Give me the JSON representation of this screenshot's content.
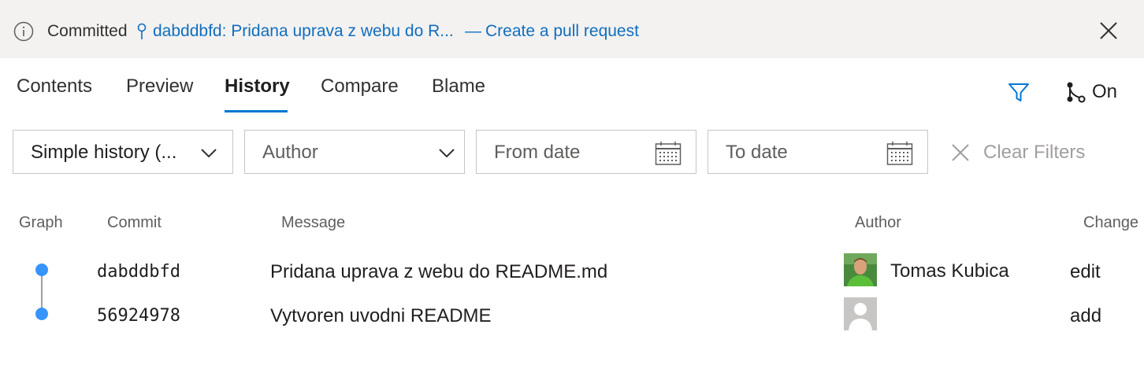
{
  "banner": {
    "status": "Committed",
    "commit_link": "dabddbfd: Pridana uprava z webu do R...",
    "separator": "—",
    "pr_link": "Create a pull request"
  },
  "tabs": [
    {
      "label": "Contents",
      "active": false
    },
    {
      "label": "Preview",
      "active": false
    },
    {
      "label": "History",
      "active": true
    },
    {
      "label": "Compare",
      "active": false
    },
    {
      "label": "Blame",
      "active": false
    }
  ],
  "toolbar": {
    "branch_toggle_label": "On"
  },
  "filters": {
    "history_mode": "Simple history (...",
    "author_placeholder": "Author",
    "from_date_placeholder": "From date",
    "to_date_placeholder": "To date",
    "clear_label": "Clear Filters"
  },
  "table": {
    "columns": [
      "Graph",
      "Commit",
      "Message",
      "Author",
      "Change"
    ],
    "rows": [
      {
        "commit": "dabddbfd",
        "message": "Pridana uprava z webu do README.md",
        "author": "Tomas Kubica",
        "change": "edit"
      },
      {
        "commit": "56924978",
        "message": "Vytvoren uvodni README",
        "author": "",
        "change": "add"
      }
    ]
  },
  "colors": {
    "accent": "#0078d4",
    "link": "#106ebe",
    "graph_node": "#3794ff",
    "banner_bg": "#f3f2f1"
  }
}
